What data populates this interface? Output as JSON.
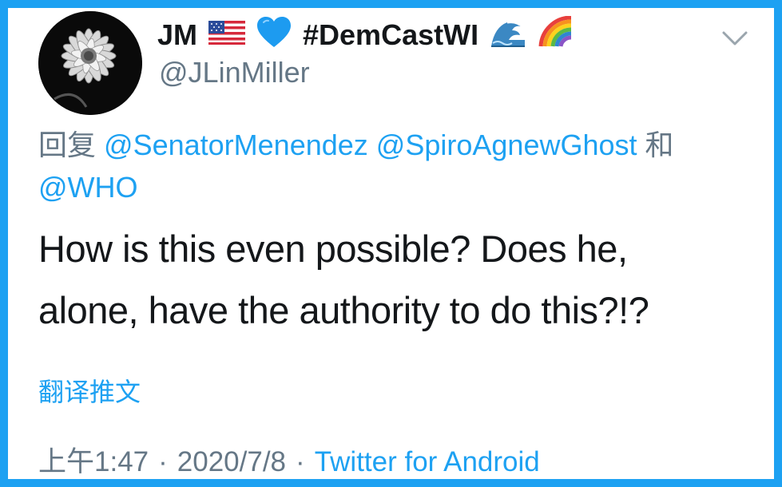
{
  "tweet": {
    "author": {
      "name": "JM",
      "name_suffix": "#DemCastWI",
      "handle": "@JLinMiller"
    },
    "reply": {
      "prefix": "回复",
      "mentions": [
        "@SenatorMenendez",
        "@SpiroAgnewGhost",
        "@WHO"
      ],
      "conjunction": "和"
    },
    "text_line1": "How is this even possible? Does he,",
    "text_line2": "alone, have the authority to do this?!?",
    "translate_label": "翻译推文",
    "meta": {
      "time": "上午1:47",
      "separator": "·",
      "date": "2020/7/8",
      "source": "Twitter for Android"
    }
  },
  "icons": {
    "avatar": "flower-photo",
    "flag": "us-flag-emoji",
    "heart": "blue-heart-emoji",
    "wave": "water-wave-emoji",
    "rainbow": "rainbow-emoji",
    "menu": "chevron-down-icon"
  },
  "colors": {
    "border": "#1da1f2",
    "link": "#1da1f2",
    "text": "#14171a",
    "secondary": "#657786",
    "heart": "#1d9bf0"
  }
}
